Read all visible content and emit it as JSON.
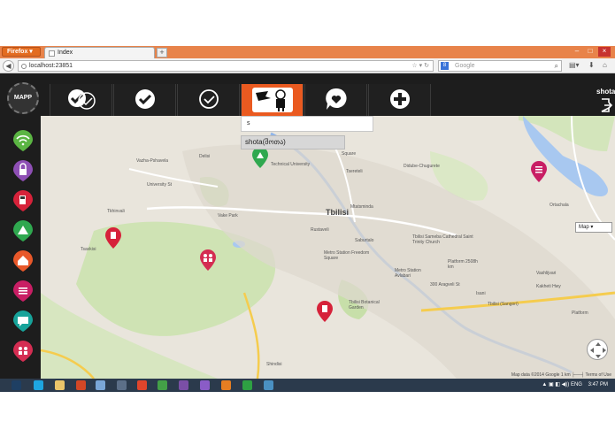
{
  "browser": {
    "app_button": "Firefox",
    "tab_title": "Index",
    "new_tab_symbol": "+",
    "url": "localhost:23851",
    "search_engine_letter": "8",
    "search_placeholder": "Google",
    "window_controls": [
      "–",
      "□",
      "×"
    ]
  },
  "app": {
    "logo_text": "MAPP",
    "username": "shota",
    "toolbar_icons": [
      "double-check-icon",
      "check-circle-icon",
      "check-outline-icon",
      "user-flag-icon",
      "heart-bubble-icon",
      "plus-icon"
    ],
    "active_tool_index": 3,
    "search": {
      "value": "s",
      "suggestion": "shota(შოთა)"
    },
    "categories": [
      {
        "icon": "wifi-icon",
        "color": "#5bb543"
      },
      {
        "icon": "lock-icon",
        "color": "#8e4fb5"
      },
      {
        "icon": "fuel-icon",
        "color": "#d6223a"
      },
      {
        "icon": "tent-icon",
        "color": "#2fa84f"
      },
      {
        "icon": "home-icon",
        "color": "#e8582a"
      },
      {
        "icon": "menu-icon",
        "color": "#c81e64"
      },
      {
        "icon": "chat-icon",
        "color": "#17a39a"
      },
      {
        "icon": "people-icon",
        "color": "#d42d52"
      }
    ]
  },
  "map": {
    "labels": {
      "city": "Tbilisi",
      "vake_park": "Vake Park",
      "metro_freedom": "Metro Station Freedom Square",
      "church": "Tbilisi Sameba Cathedral Saint Trinity Church",
      "botanical": "Tbilisi Botanical Garden",
      "tech_univ": "Technical University",
      "tsereteli": "Tsereteli",
      "delisi": "Delisi",
      "didube": "Didube-Chugurete",
      "mtatsminda": "Mtatsminda",
      "rustaveli": "Rustaveli",
      "avlabari": "Metro Station Avlabari",
      "platform1": "Platform 2508h km",
      "platform2": "Platform",
      "tbilisi_sangori": "Tbilisi (Sangori)",
      "ortachala": "Ortachala",
      "vazha": "Vazha-Pshavela",
      "vashlijvari": "Vashlijvari",
      "square": "Square",
      "saburtalo": "Saburtalo",
      "kakheti": "Kakheti Hwy",
      "isani": "Isani",
      "shindisi": "Shindisi",
      "tkhinvali": "Tkhinvali",
      "university": "University St",
      "tsavkisi": "Tsavkisi",
      "agmashenebeli": "300 Aragveli St"
    },
    "type_control": "Map",
    "footer": "Map data ©2014 Google   1 km ├──┤   Terms of Use"
  },
  "taskbar": {
    "language": "ENG",
    "time": "3:47 PM"
  }
}
